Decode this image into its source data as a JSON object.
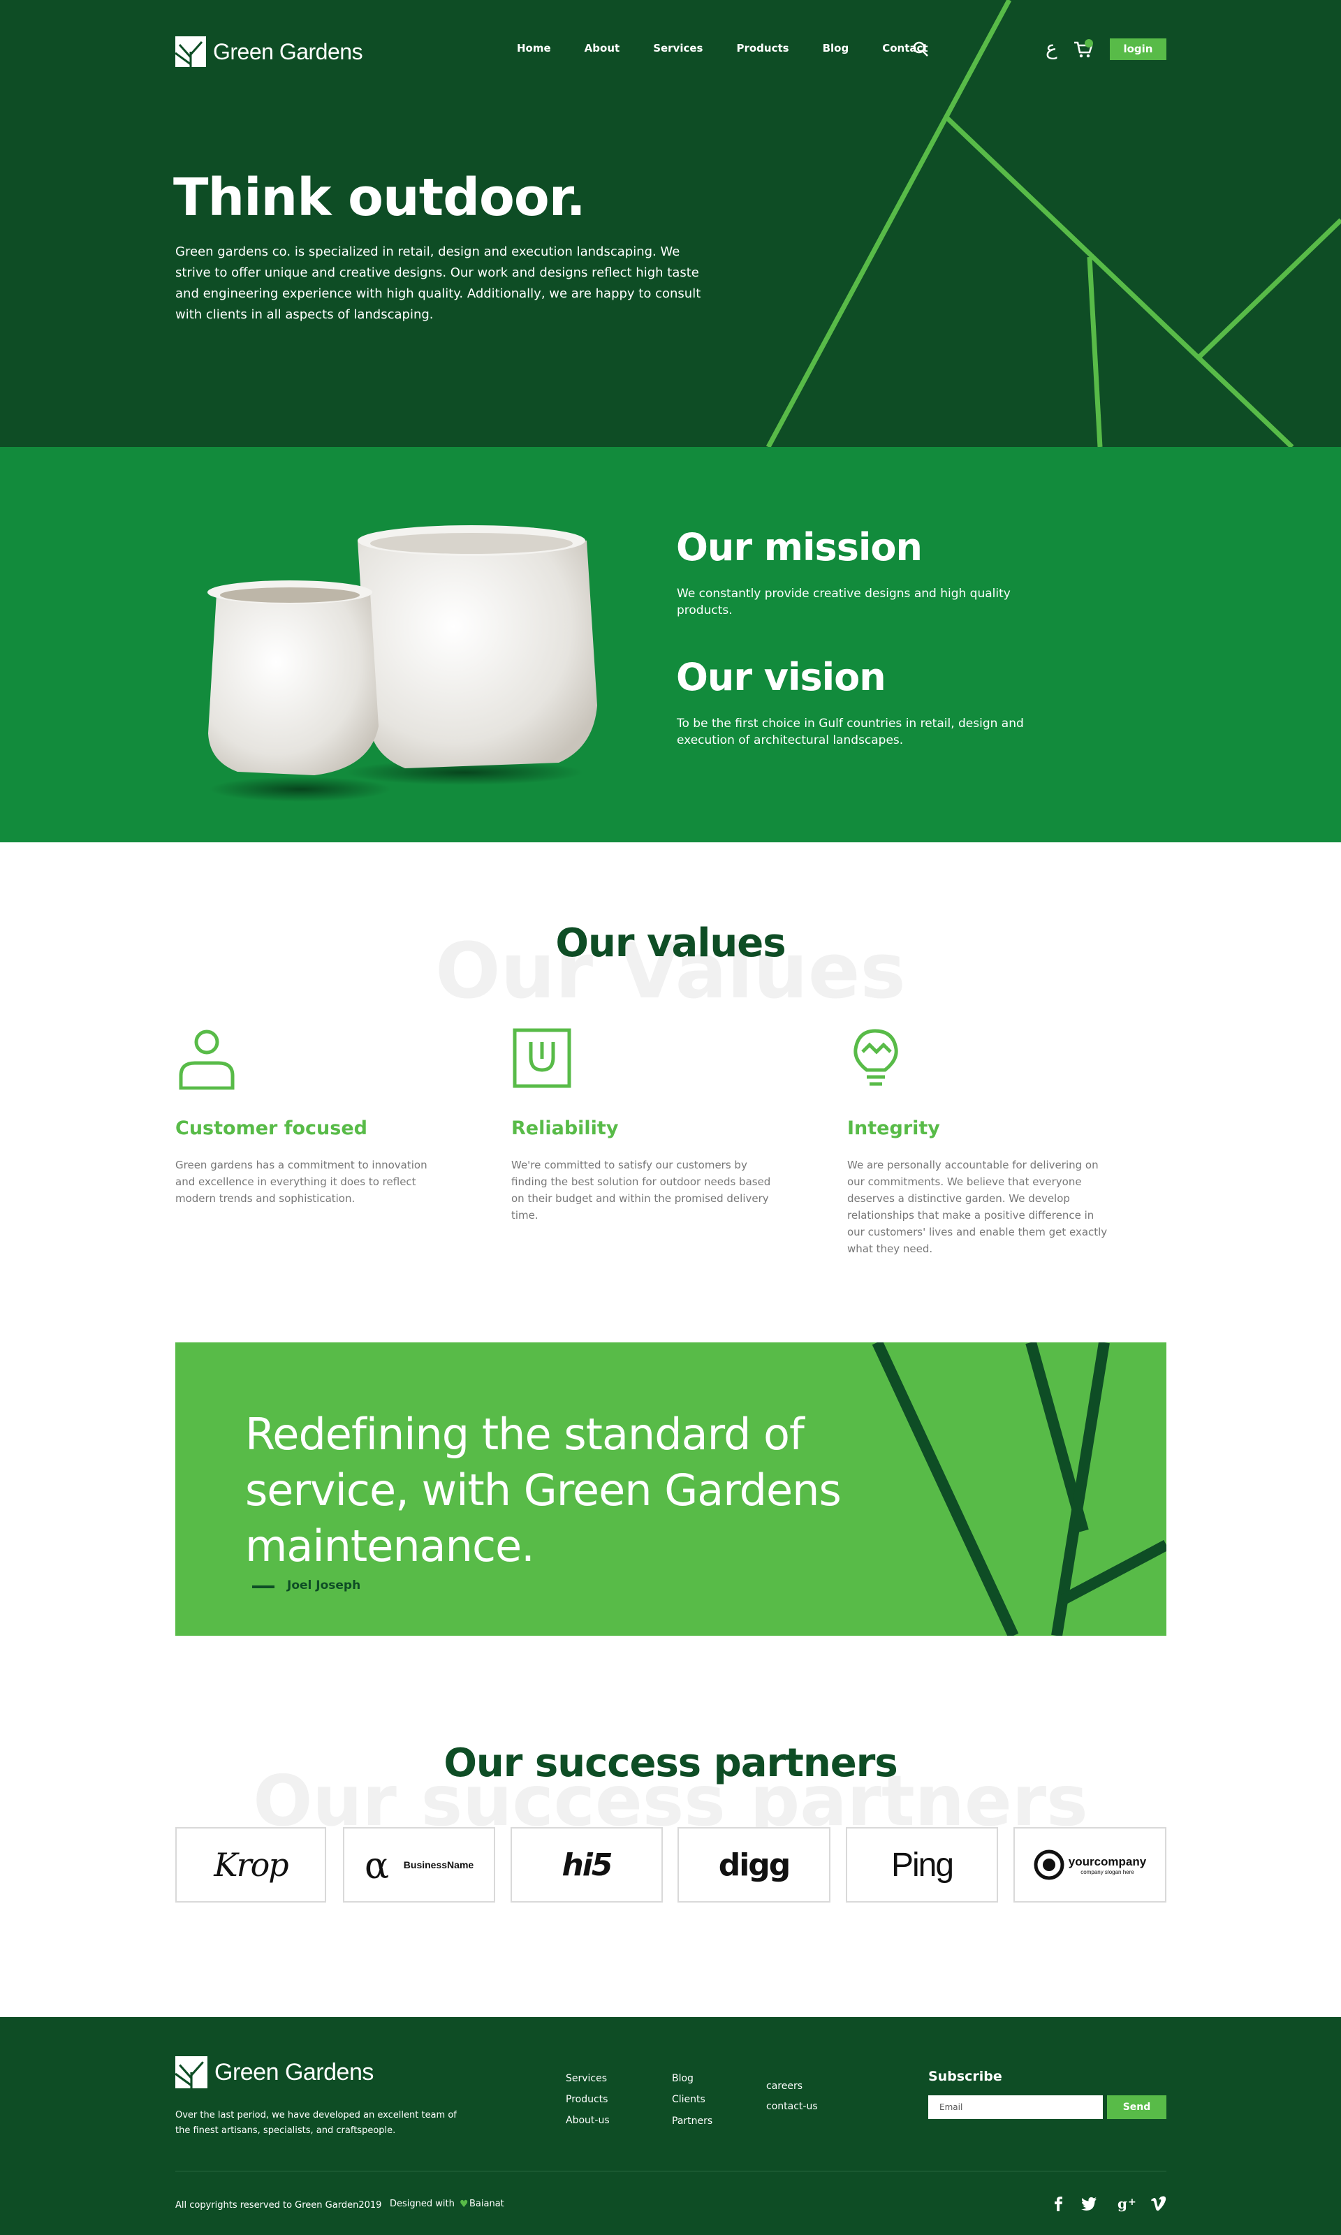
{
  "brand": {
    "name": "Green Gardens"
  },
  "nav": {
    "items": [
      "Home",
      "About",
      "Services",
      "Products",
      "Blog",
      "Contact"
    ],
    "lang_label": "ع",
    "login_label": "login"
  },
  "hero": {
    "title": "Think outdoor.",
    "text": "Green gardens co. is specialized in retail, design and execution landscaping. We strive to offer unique and creative designs. Our work and designs reflect high taste and engineering experience with high quality. Additionally, we are happy to consult with clients in all aspects of landscaping."
  },
  "mission": {
    "mission_title": "Our mission",
    "mission_text": "We constantly provide creative designs and high quality products.",
    "vision_title": "Our vision",
    "vision_text": "To be the first choice in Gulf countries in retail, design and execution of architectural landscapes."
  },
  "values": {
    "ghost": "Our Values",
    "title": "Our values",
    "items": [
      {
        "title": "Customer focused",
        "text": "Green gardens has a commitment to innovation and excellence in everything it does to reflect modern trends and sophistication.",
        "icon": "person-icon"
      },
      {
        "title": "Reliability",
        "text": "We're committed to satisfy our customers by finding the best solution for outdoor needs based on their budget and within the promised delivery time.",
        "icon": "shield-icon"
      },
      {
        "title": "Integrity",
        "text": "We are personally accountable for delivering on our commitments. We believe that everyone deserves a distinctive garden. We develop relationships that make a positive difference in our customers' lives and enable them get exactly what they need.",
        "icon": "lightbulb-icon"
      }
    ]
  },
  "quote": {
    "text": "Redefining the standard of service, with Green Gardens maintenance.",
    "author": "Joel Joseph"
  },
  "partners": {
    "ghost": "Our success partners",
    "title": "Our success partners",
    "logos": [
      "Krop",
      "BusinessName",
      "hi5",
      "digg",
      "Ping",
      "yourcompany",
      "company slogan here"
    ]
  },
  "footer": {
    "about": "Over the last period, we have developed an excellent team of the finest artisans, specialists, and craftspeople.",
    "col1": [
      "Services",
      "Products",
      "About-us"
    ],
    "col2": [
      "Blog",
      "Clients",
      "Partners"
    ],
    "col3": [
      "careers",
      "contact-us"
    ],
    "subscribe_title": "Subscribe",
    "email_placeholder": "Email",
    "send_label": "Send",
    "copyright": "All copyrights reserved to Green Garden2019",
    "designed_with": "Designed with",
    "designer": "Baianat",
    "social": [
      "facebook-icon",
      "twitter-icon",
      "google-plus-icon",
      "vimeo-icon"
    ]
  },
  "colors": {
    "dark_green": "#0e4d25",
    "mid_green": "#128b3c",
    "light_green": "#58bb48"
  }
}
